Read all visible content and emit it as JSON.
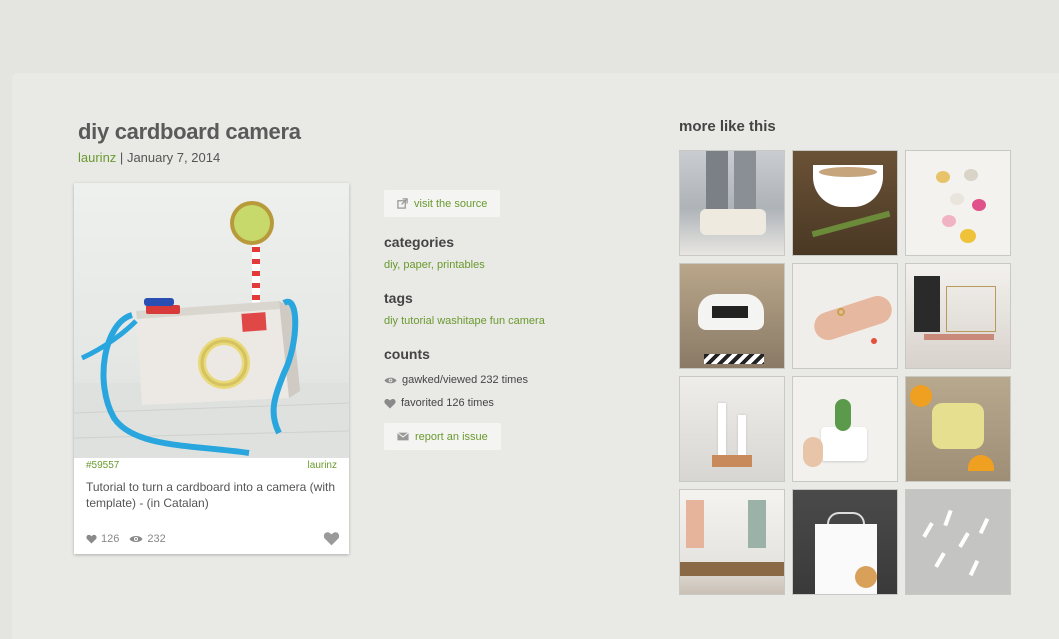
{
  "post": {
    "title": "diy cardboard camera",
    "author": "laurinz",
    "separator": "|",
    "date": "January 7, 2014"
  },
  "card": {
    "id": "#59557",
    "author": "laurinz",
    "description": "Tutorial to turn a cardboard into a camera (with template) - (in Catalan)",
    "likes": "126",
    "views": "232"
  },
  "actions": {
    "visit_source": "visit the source",
    "report_issue": "report an issue"
  },
  "categories": {
    "heading": "categories",
    "items": [
      "diy",
      "paper",
      "printables"
    ]
  },
  "tags": {
    "heading": "tags",
    "value": "diy tutorial washitape fun camera"
  },
  "counts": {
    "heading": "counts",
    "viewed": "gawked/viewed 232 times",
    "favorited": "favorited 126 times"
  },
  "more": {
    "heading": "more like this",
    "thumbs": [
      "cozy-socks",
      "tea-cup",
      "clay-hearts",
      "eames-chair",
      "gold-ring",
      "vanity-jewelry",
      "candles",
      "cactus-pot",
      "herb-butter",
      "dining-room",
      "tshirt-hanger",
      "clay-feathers"
    ]
  },
  "colors": {
    "accent": "#6a9a2f",
    "background": "#e4e4e1",
    "panel": "#e9e9e6"
  }
}
